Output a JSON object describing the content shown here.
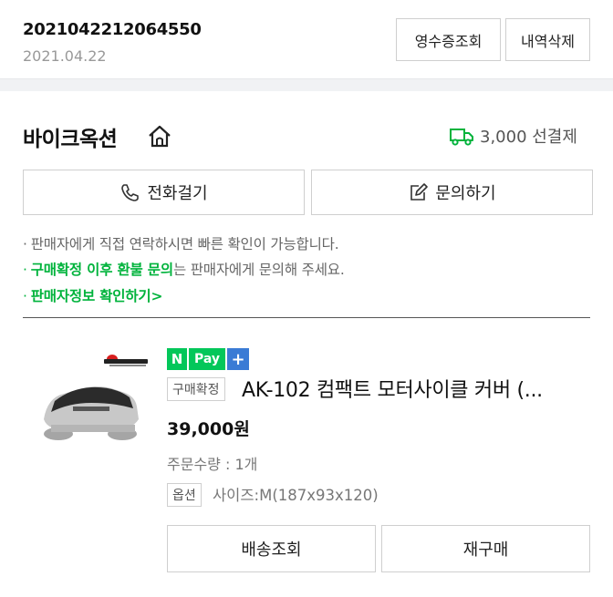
{
  "order": {
    "number": "2021042212064550",
    "date": "2021.04.22",
    "receipt_label": "영수증조회",
    "delete_label": "내역삭제"
  },
  "seller": {
    "name": "바이크옥션",
    "shipping_fee": "3,000 선결제",
    "call_label": "전화걸기",
    "inquiry_label": "문의하기",
    "notices": {
      "line1": "판매자에게 직접 연락하시면 빠른 확인이 가능합니다.",
      "line2_highlight": "구매확정 이후 환불 문의",
      "line2_rest": "는 판매자에게 문의해 주세요.",
      "line3_link": "판매자정보 확인하기"
    }
  },
  "product": {
    "npay_n": "N",
    "npay_pay": "Pay",
    "npay_plus": "+",
    "status_tag": "구매확정",
    "name": "AK-102 컴팩트 모터사이클 커버 (...",
    "price": "39,000원",
    "quantity": "주문수량 : 1개",
    "option_tag": "옵션",
    "option_value": "사이즈:M(187x93x120)",
    "track_label": "배송조회",
    "rebuy_label": "재구매"
  },
  "colors": {
    "accent_green": "#00b33c",
    "npay_green": "#03c75a",
    "npay_plus_blue": "#3a7bd5"
  }
}
